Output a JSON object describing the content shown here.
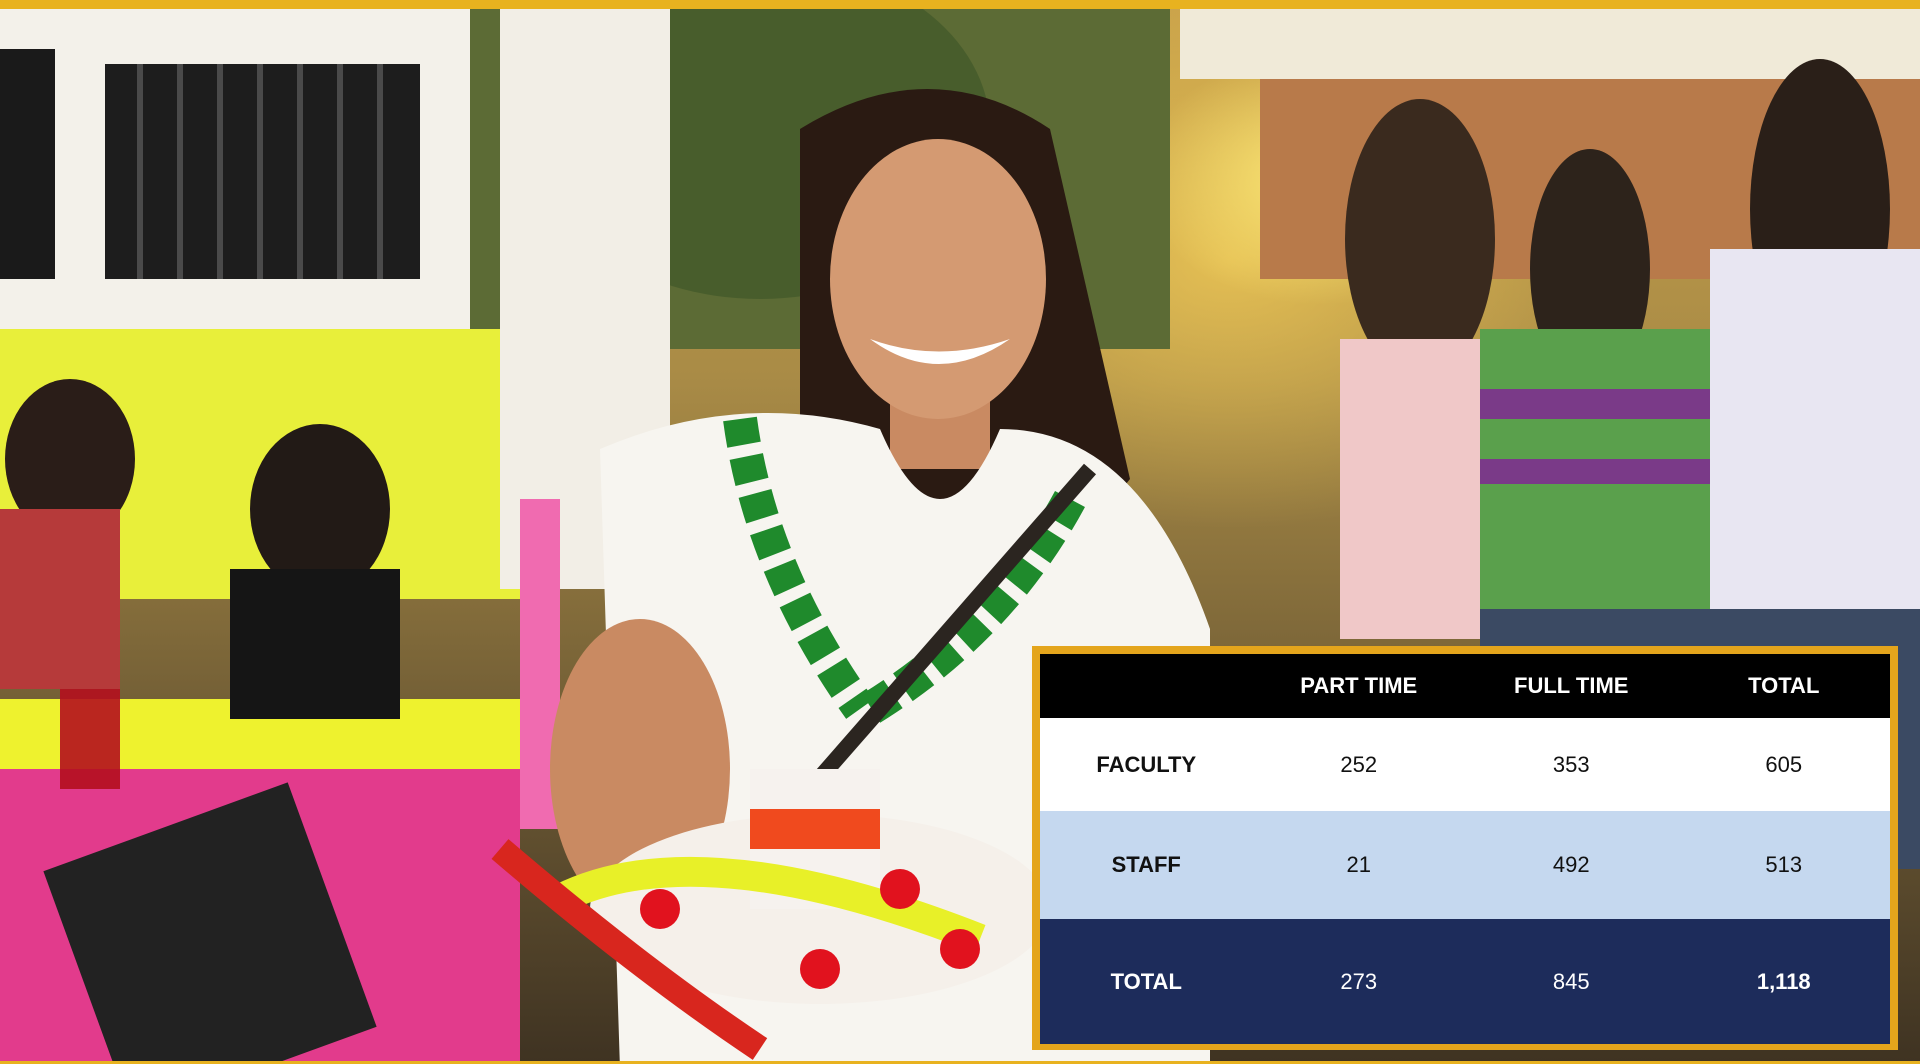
{
  "colors": {
    "frame": "#e4a51c",
    "header_bg": "#000000",
    "faculty_bg": "#ffffff",
    "staff_bg": "#c5d8ef",
    "total_bg": "#1d2c5b"
  },
  "table": {
    "headers": [
      "",
      "PART TIME",
      "FULL TIME",
      "TOTAL"
    ],
    "rows": [
      {
        "label": "FACULTY",
        "part_time": "252",
        "full_time": "353",
        "total": "605"
      },
      {
        "label": "STAFF",
        "part_time": "21",
        "full_time": "492",
        "total": "513"
      },
      {
        "label": "TOTAL",
        "part_time": "273",
        "full_time": "845",
        "total": "1,118"
      }
    ]
  }
}
